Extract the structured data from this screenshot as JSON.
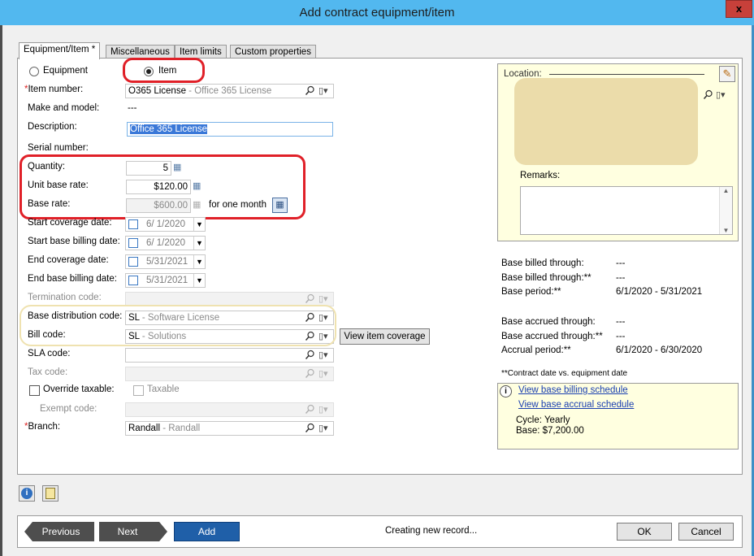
{
  "window": {
    "title": "Add contract equipment/item",
    "close_glyph": "x"
  },
  "tabs": [
    "Equipment/Item *",
    "Miscellaneous",
    "Item limits",
    "Custom properties"
  ],
  "type_radio": {
    "equipment": "Equipment",
    "item": "Item",
    "selected": "Item"
  },
  "form": {
    "item_number": {
      "label": "Item number:",
      "value": "O365 License",
      "sub": "Office 365 License"
    },
    "make_model": {
      "label": "Make and model:",
      "value": "---"
    },
    "description": {
      "label": "Description:",
      "value": "Office 365 License"
    },
    "serial_number": {
      "label": "Serial number:"
    },
    "quantity": {
      "label": "Quantity:",
      "value": "5"
    },
    "unit_base_rate": {
      "label": "Unit base rate:",
      "value": "$120.00"
    },
    "base_rate": {
      "label": "Base rate:",
      "value": "$600.00",
      "suffix": "for one month"
    },
    "start_coverage_date": {
      "label": "Start coverage date:",
      "value": "6/ 1/2020"
    },
    "start_base_billing_date": {
      "label": "Start base billing date:",
      "value": "6/ 1/2020"
    },
    "end_coverage_date": {
      "label": "End coverage date:",
      "value": "5/31/2021"
    },
    "end_base_billing_date": {
      "label": "End base billing date:",
      "value": "5/31/2021"
    },
    "termination_code": {
      "label": "Termination code:"
    },
    "base_distribution_code": {
      "label": "Base distribution code:",
      "value": "SL",
      "sub": "Software License"
    },
    "bill_code": {
      "label": "Bill code:",
      "value": "SL",
      "sub": "Solutions"
    },
    "view_item_coverage": "View item coverage",
    "sla_code": {
      "label": "SLA code:"
    },
    "tax_code": {
      "label": "Tax code:"
    },
    "override_taxable": "Override taxable:",
    "taxable": "Taxable",
    "exempt_code": {
      "label": "Exempt code:"
    },
    "branch": {
      "label": "Branch:",
      "value": "Randall",
      "sub": "Randall"
    },
    "required_marker": "*"
  },
  "location_panel": {
    "location_label": "Location:",
    "remarks_label": "Remarks:"
  },
  "billing_summary": {
    "base_billed_through": {
      "label": "Base billed through:",
      "value": "---"
    },
    "base_billed_through_contract": {
      "label": "Base billed through:**",
      "value": "---"
    },
    "base_period": {
      "label": "Base period:**",
      "value": "6/1/2020 - 5/31/2021"
    },
    "base_accrued_through": {
      "label": "Base accrued through:",
      "value": "---"
    },
    "base_accrued_through_contract": {
      "label": "Base accrued through:**",
      "value": "---"
    },
    "accrual_period": {
      "label": "Accrual period:**",
      "value": "6/1/2020 - 6/30/2020"
    },
    "footnote": "**Contract date vs. equipment date"
  },
  "info_panel": {
    "view_billing": "View base billing schedule",
    "view_accrual": "View base accrual schedule",
    "cycle": "Cycle: Yearly",
    "base": "Base: $7,200.00"
  },
  "footer": {
    "previous": "Previous",
    "next": "Next",
    "add": "Add",
    "status": "Creating new record...",
    "ok": "OK",
    "cancel": "Cancel"
  },
  "colors": {
    "title_bar": "#52b8ef",
    "add_button": "#1f5fa8",
    "highlight_red": "#e02028",
    "highlight_yellow": "#efe2b0"
  }
}
